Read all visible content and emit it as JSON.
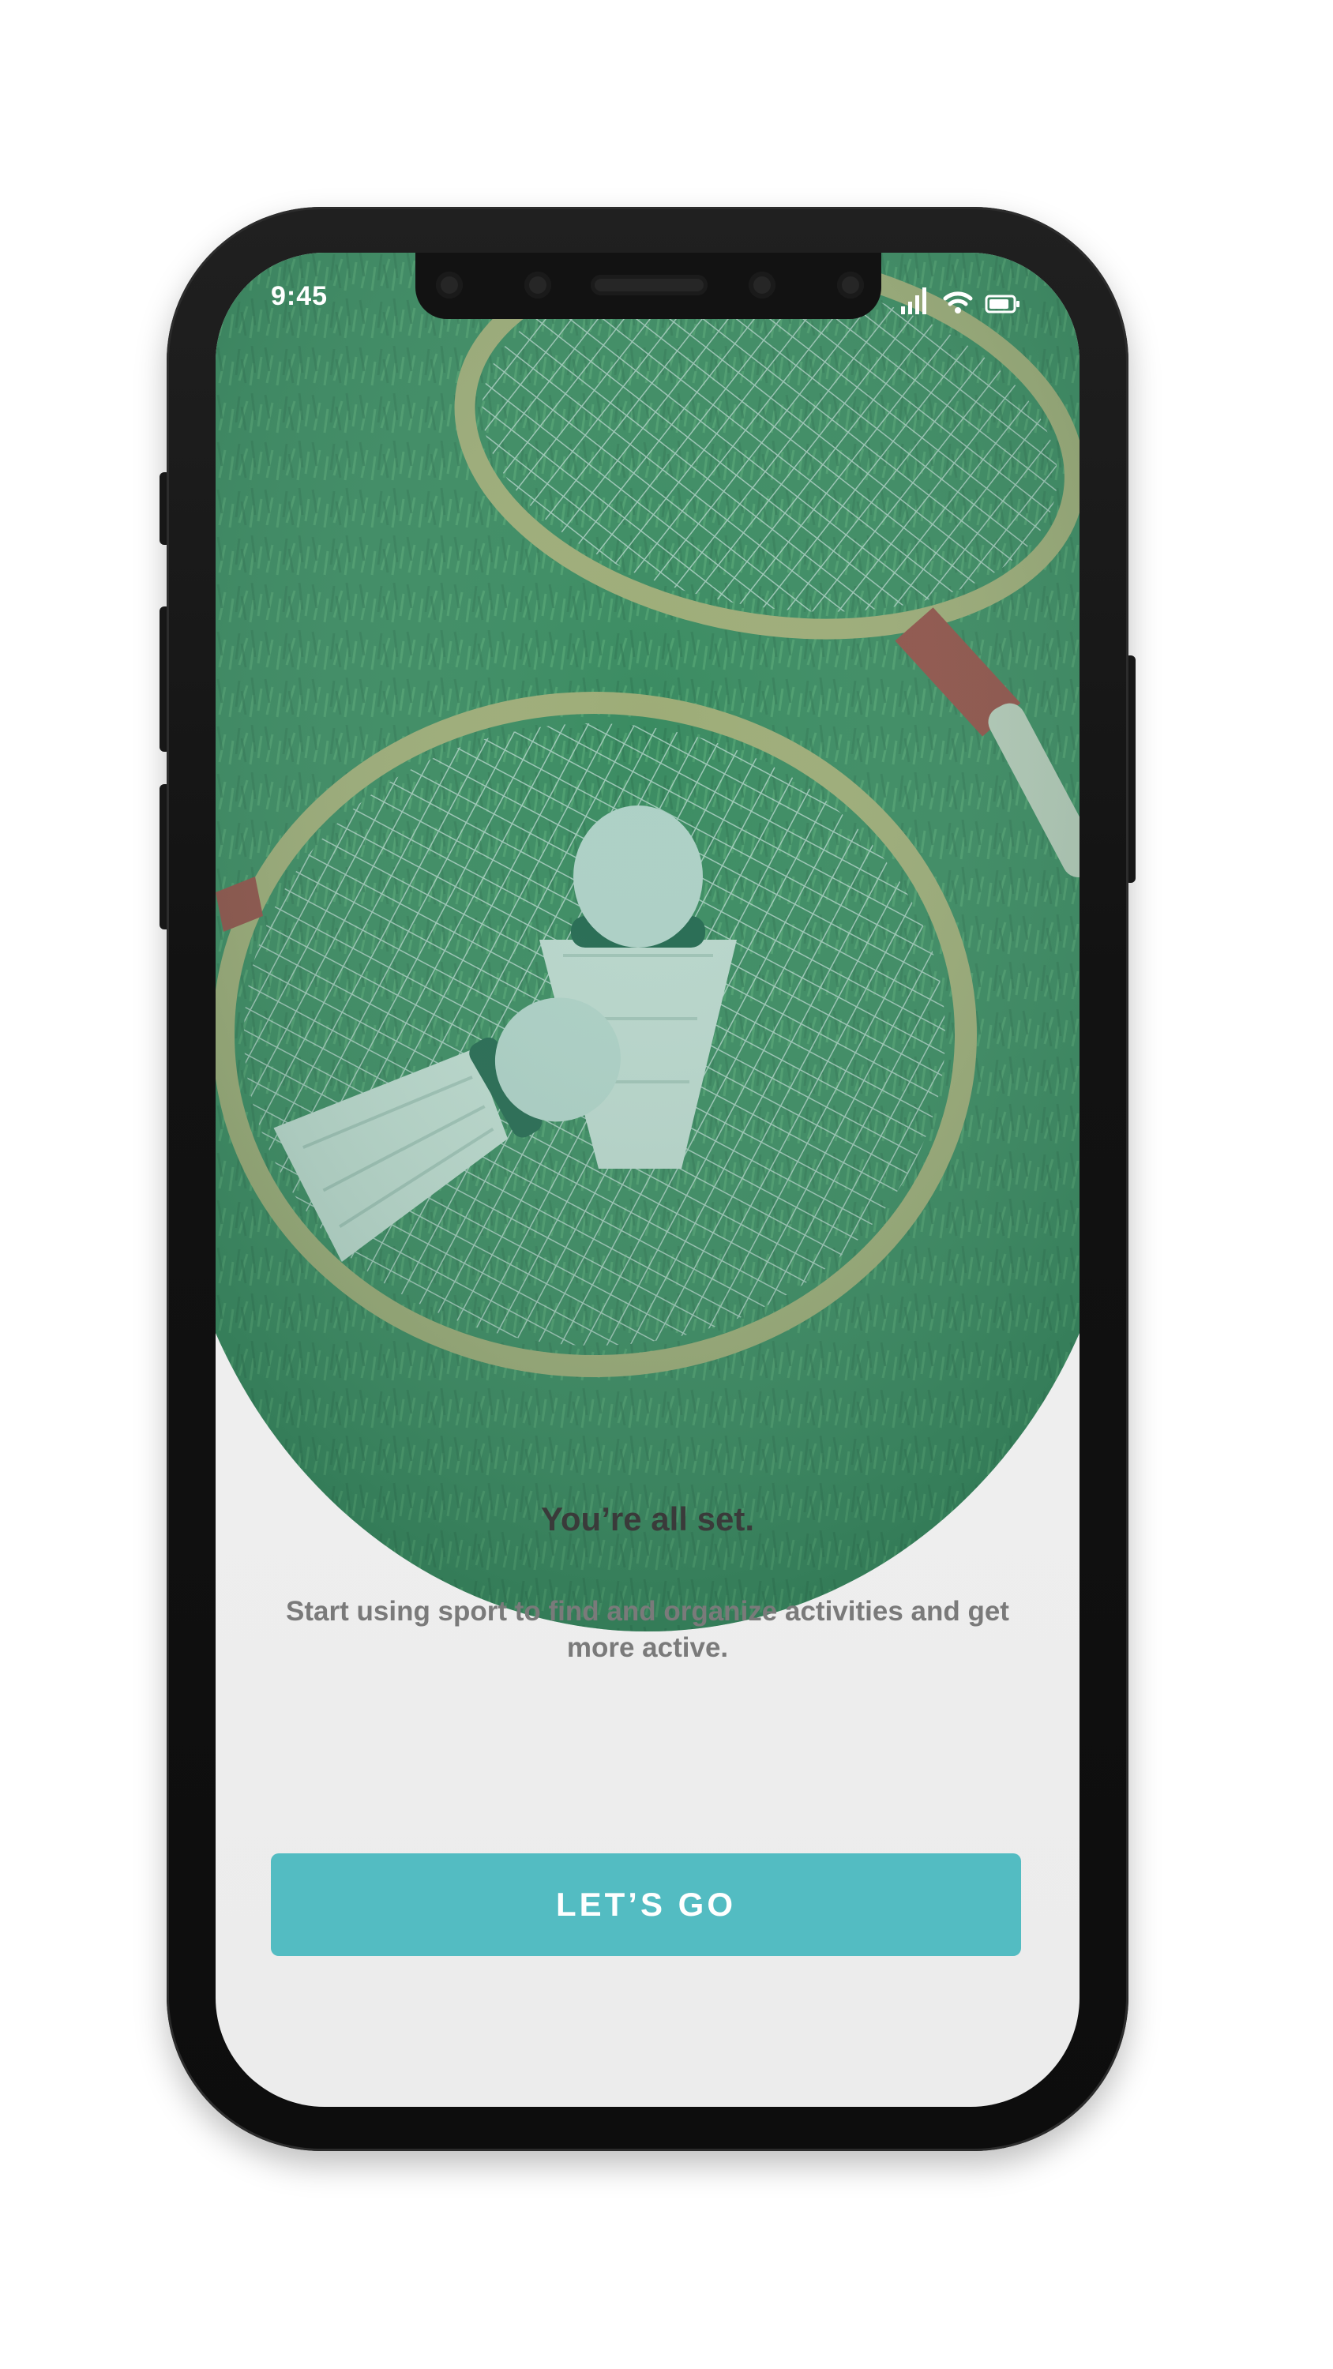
{
  "status_bar": {
    "time": "9:45",
    "icons": [
      "signal-icon",
      "wifi-icon",
      "battery-icon"
    ]
  },
  "hero": {
    "image": "badminton-rackets-and-shuttlecocks-on-grass"
  },
  "onboarding": {
    "title": "You’re all set.",
    "subtitle": "Start using sport to find  and organize activities and get more active.",
    "cta_label": "LET’S GO"
  },
  "colors": {
    "accent": "#53bcc2",
    "title_text": "#3a3a3a",
    "subtitle_text": "#7a7a7a",
    "background": "#eeeeee",
    "hero_tint": "#2e8f6e"
  }
}
